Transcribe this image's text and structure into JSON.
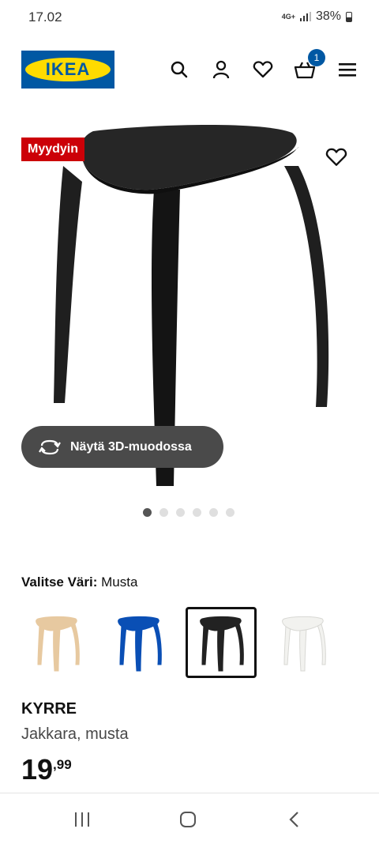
{
  "status": {
    "time": "17.02",
    "network": "4G+",
    "battery": "38%"
  },
  "header": {
    "logo_text": "IKEA",
    "cart_count": "1",
    "icons": [
      "search-icon",
      "user-icon",
      "heart-icon",
      "cart-icon",
      "menu-icon"
    ]
  },
  "product": {
    "badge": "Myydyin",
    "view3d_label": "Näytä 3D-muodossa",
    "image_count": 6,
    "active_image": 1,
    "color_prefix": "Valitse Väri:",
    "color_value": " Musta",
    "swatches": [
      {
        "name": "birch",
        "color": "#e7c9a0"
      },
      {
        "name": "blue",
        "color": "#0a4fb5"
      },
      {
        "name": "black",
        "color": "#222222"
      },
      {
        "name": "white",
        "color": "#f2f2ef"
      }
    ],
    "selected_swatch": 2,
    "name": "KYRRE",
    "description": "Jakkara, musta",
    "price_int": "19",
    "price_dec": ",99"
  },
  "colors": {
    "brand_blue": "#0058a3",
    "brand_yellow": "#ffdb00",
    "badge_red": "#cc0008"
  }
}
